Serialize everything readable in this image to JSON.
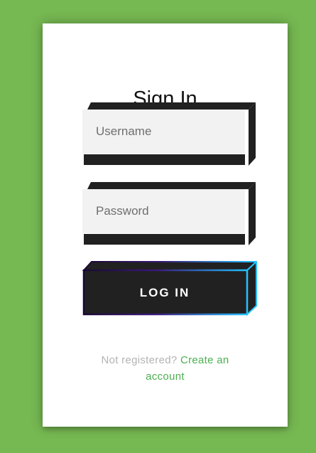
{
  "form": {
    "title": "Sign In",
    "username_placeholder": "Username",
    "password_placeholder": "Password",
    "login_label": "LOG IN",
    "footer_text": "Not registered?",
    "create_account_link": "Create an account"
  },
  "colors": {
    "background": "#76b852",
    "card": "#ffffff",
    "input_fill": "#f2f2f2",
    "block_dark": "#212121",
    "button_fill": "#212121",
    "button_glow_start": "#2b0a4a",
    "button_glow_end": "#22c3ff",
    "link": "#4CAF50",
    "muted_text": "#b3b3b3"
  }
}
